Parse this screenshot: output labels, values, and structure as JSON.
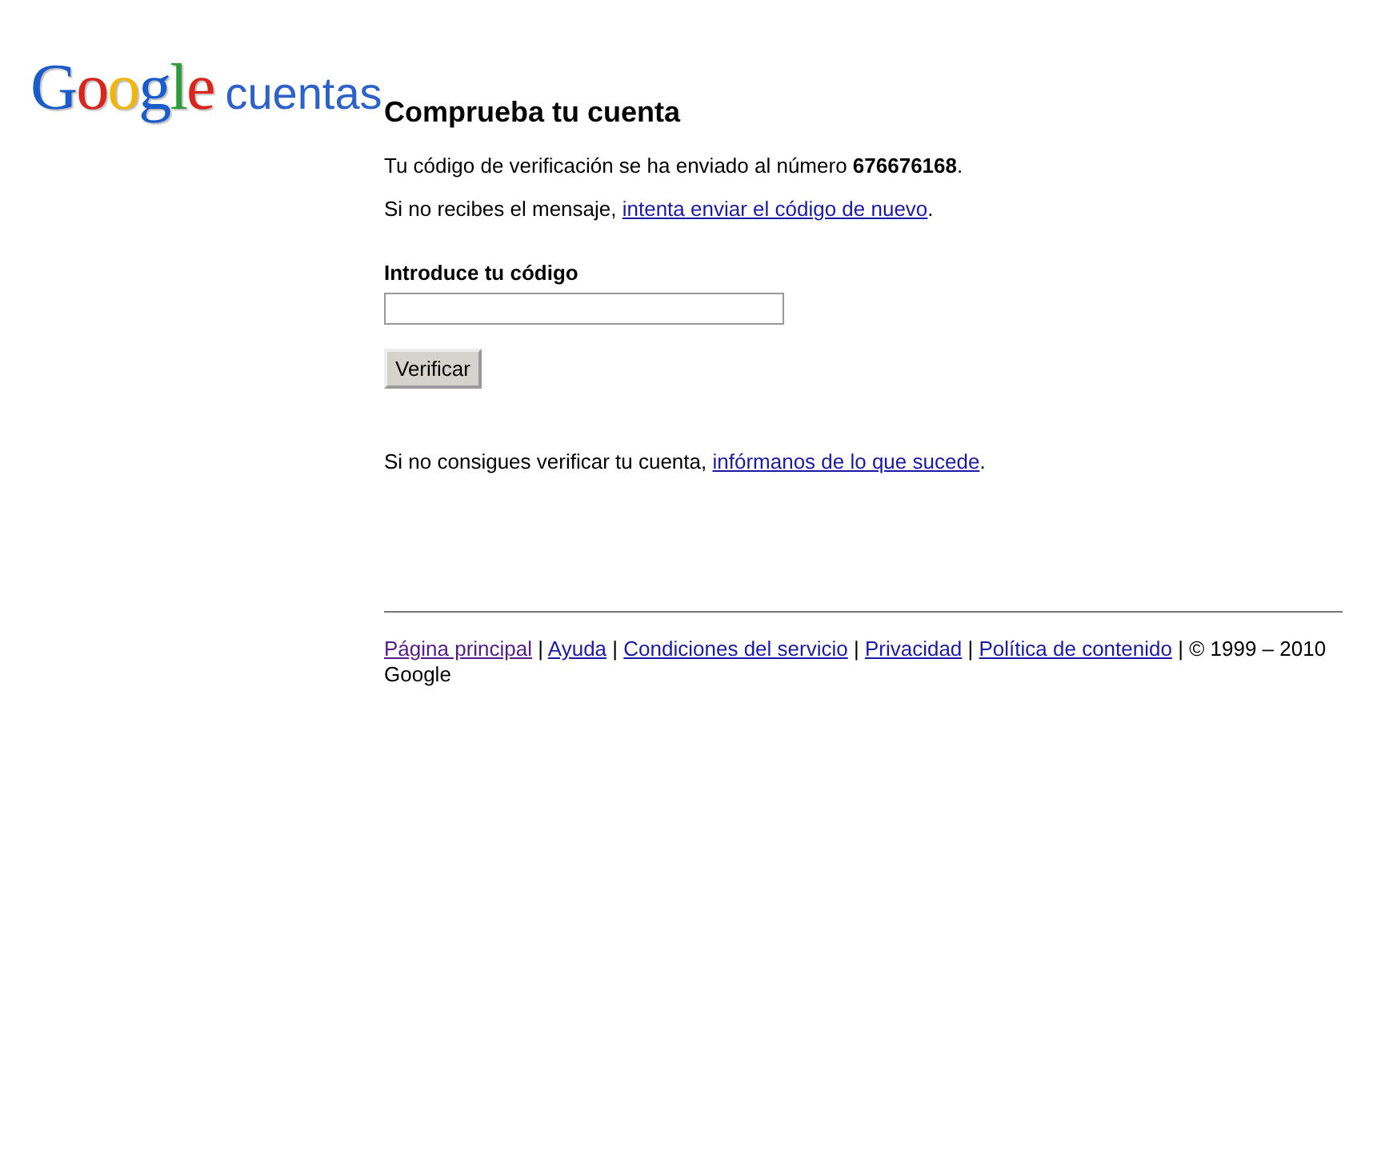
{
  "logo": {
    "brand": "Google",
    "product": "cuentas"
  },
  "heading": "Comprueba tu cuenta",
  "sent_message": "Tu código de verificación se ha enviado al número **676676168**.",
  "resend": {
    "before": "Si no recibes el mensaje, ",
    "link": "intenta enviar el código de nuevo",
    "after": "."
  },
  "code_field": {
    "label": "Introduce tu código"
  },
  "verify_button": "Verificar",
  "help": {
    "before": "Si no consigues verificar tu cuenta, ",
    "link": "infórmanos de lo que sucede",
    "after": "."
  },
  "footer": {
    "separator": "|",
    "links": [
      {
        "label": "Página principal",
        "visited": true
      },
      {
        "label": "Ayuda",
        "visited": false
      },
      {
        "label": "Condiciones del servicio",
        "visited": false
      },
      {
        "label": "Privacidad",
        "visited": false
      },
      {
        "label": "Política de contenido",
        "visited": false
      }
    ],
    "copyright": "© 1999 – 2010 Google"
  }
}
